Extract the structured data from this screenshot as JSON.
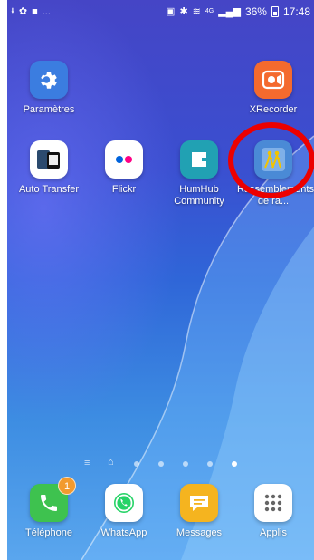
{
  "status_bar": {
    "left_icons": [
      "download-icon",
      "accessibility-icon",
      "video-icon",
      "more-icon"
    ],
    "left_more": "...",
    "right_icons": [
      "cast-icon",
      "bluetooth-icon",
      "wifi-icon",
      "signal-icon"
    ],
    "network": "4G",
    "battery": "36%",
    "time": "17:48"
  },
  "apps": [
    {
      "label": "Paramètres",
      "icon": "gear-icon",
      "color": "#3b7de0"
    },
    {
      "label": "XRecorder",
      "icon": "video-recorder-icon",
      "color": "#f46a2e"
    },
    {
      "label": "Auto Transfer",
      "icon": "phone-transfer-icon",
      "color": "#2b4a6e"
    },
    {
      "label": "Flickr",
      "icon": "flickr-icon",
      "color": "#ffffff"
    },
    {
      "label": "HumHub Community",
      "icon": "humhub-icon",
      "color": "#21a1b3"
    },
    {
      "label": "Rassemblements de ra...",
      "icon": "hikers-icon",
      "color": "#3f7fd0"
    }
  ],
  "dock": [
    {
      "label": "Téléphone",
      "icon": "phone-icon",
      "color": "#3ec24f",
      "badge": "1"
    },
    {
      "label": "WhatsApp",
      "icon": "whatsapp-icon",
      "color": "#ffffff"
    },
    {
      "label": "Messages",
      "icon": "messages-icon",
      "color": "#f5b41f"
    },
    {
      "label": "Applis",
      "icon": "apps-grid-icon",
      "color": "#ffffff"
    }
  ],
  "pages": {
    "count": 6,
    "active": 6
  },
  "highlight_color": "#ec0000"
}
